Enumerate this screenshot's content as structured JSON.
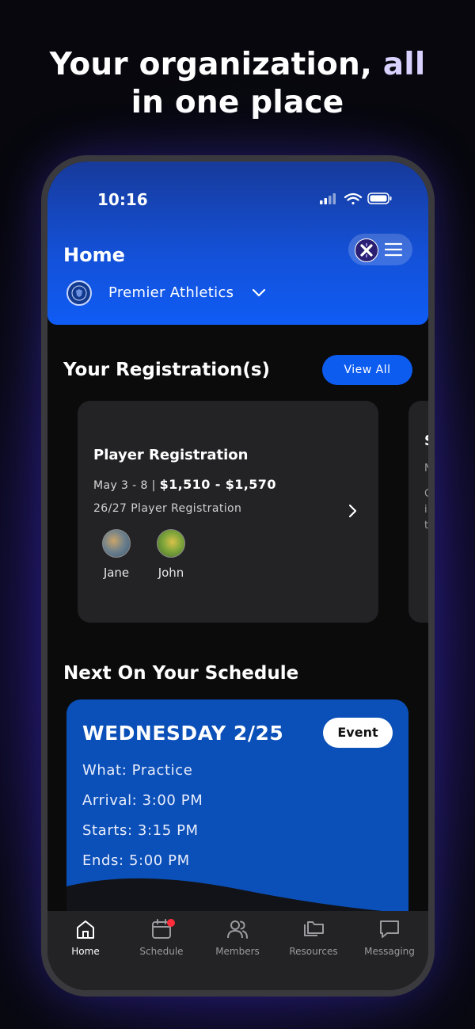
{
  "headline": {
    "main": "Your organization,",
    "accent": "all",
    "line2": "in one place"
  },
  "status_bar": {
    "time": "10:16",
    "icons": [
      "cellular-signal-icon",
      "wifi-icon",
      "battery-icon"
    ]
  },
  "header": {
    "title": "Home",
    "org_name": "Premier Athletics"
  },
  "registrations": {
    "section_title": "Your Registration(s)",
    "view_all_label": "View All",
    "card": {
      "title": "Player Registration",
      "dates": "May 3 - 8 |",
      "price": "$1,510 - $1,570",
      "subtitle": "26/27 Player Registration",
      "people": [
        {
          "name": "Jane"
        },
        {
          "name": "John"
        }
      ]
    },
    "peek_card": {
      "lines": [
        "S",
        "N",
        "C",
        "i",
        "t"
      ]
    }
  },
  "schedule": {
    "section_title": "Next On Your Schedule",
    "day": "WEDNESDAY 2/25",
    "badge": "Event",
    "what": "What: Practice",
    "arrival": "Arrival: 3:00 PM",
    "starts": "Starts: 3:15 PM",
    "ends": "Ends: 5:00 PM"
  },
  "tabs": [
    {
      "label": "Home",
      "icon": "home-icon",
      "active": true
    },
    {
      "label": "Schedule",
      "icon": "calendar-icon",
      "active": false
    },
    {
      "label": "Members",
      "icon": "members-icon",
      "active": false
    },
    {
      "label": "Resources",
      "icon": "folder-icon",
      "active": false
    },
    {
      "label": "Messaging",
      "icon": "chat-icon",
      "active": false
    }
  ],
  "colors": {
    "accent_blue": "#0d5cf0",
    "schedule_blue": "#0b4fb8",
    "notification": "#ff2d3a",
    "card_bg": "#232325"
  }
}
